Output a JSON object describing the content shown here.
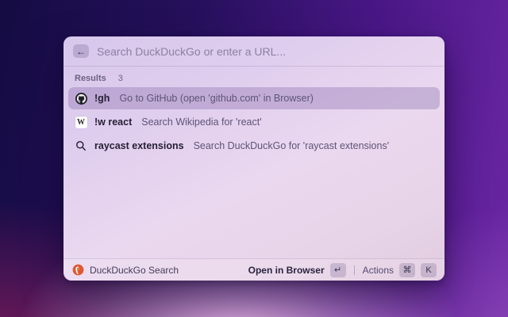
{
  "window": {
    "search": {
      "back_glyph": "←",
      "placeholder": "Search DuckDuckGo or enter a URL..."
    },
    "results": {
      "label": "Results",
      "count": "3",
      "items": [
        {
          "icon": "github",
          "title": "!gh",
          "subtitle": "Go to GitHub (open 'github.com' in Browser)",
          "selected": true
        },
        {
          "icon": "wikipedia",
          "wiki_glyph": "W",
          "title": "!w react",
          "subtitle": "Search Wikipedia for 'react'",
          "selected": false
        },
        {
          "icon": "search",
          "title": "raycast extensions",
          "subtitle": "Search DuckDuckGo for 'raycast extensions'",
          "selected": false
        }
      ]
    },
    "footer": {
      "app_icon": "duckduckgo",
      "app_name": "DuckDuckGo Search",
      "primary_action": "Open in Browser",
      "primary_key": "↵",
      "actions_label": "Actions",
      "actions_keys": [
        "⌘",
        "K"
      ]
    }
  },
  "colors": {
    "duckduckgo_orange": "#de5833",
    "github_dark": "#1b1f23",
    "selection_lavender": "#c9b5dd",
    "background_indigo": "#150c43",
    "background_violet": "#6b27a4"
  }
}
